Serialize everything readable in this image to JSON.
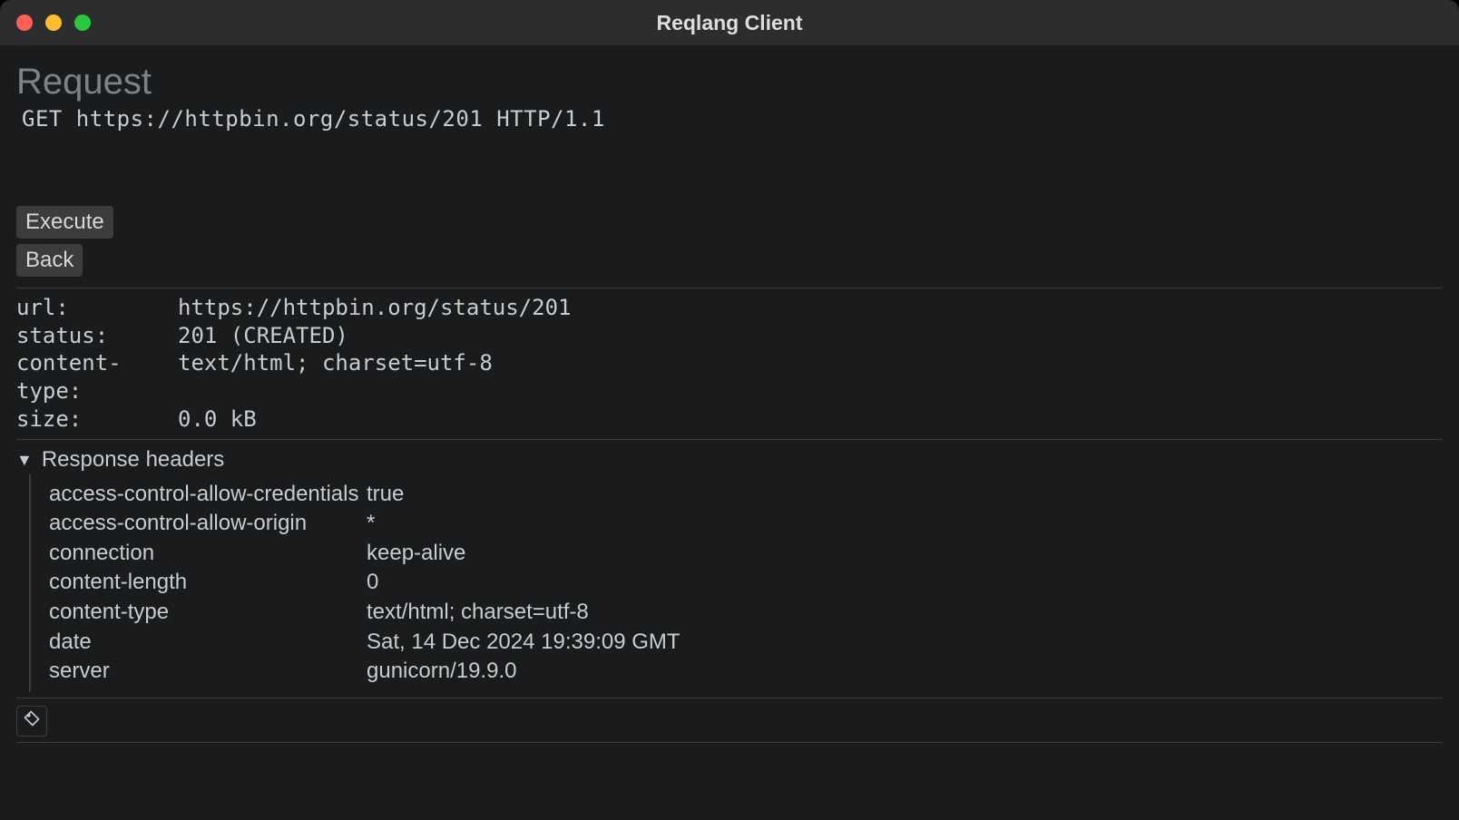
{
  "window": {
    "title": "Reqlang Client"
  },
  "page": {
    "heading": "Request",
    "request_line": "GET https://httpbin.org/status/201 HTTP/1.1"
  },
  "buttons": {
    "execute": "Execute",
    "back": "Back"
  },
  "summary": {
    "url": {
      "label": "url:",
      "value": "https://httpbin.org/status/201"
    },
    "status": {
      "label": "status:",
      "value": "201 (CREATED)"
    },
    "content_type": {
      "label": "content-type:",
      "value": "text/html; charset=utf-8"
    },
    "size": {
      "label": "size:",
      "value": "0.0 kB"
    }
  },
  "response_headers_section": {
    "title": "Response headers",
    "headers": [
      {
        "k": "access-control-allow-credentials",
        "v": "true"
      },
      {
        "k": "access-control-allow-origin",
        "v": "*"
      },
      {
        "k": "connection",
        "v": "keep-alive"
      },
      {
        "k": "content-length",
        "v": "0"
      },
      {
        "k": "content-type",
        "v": "text/html; charset=utf-8"
      },
      {
        "k": "date",
        "v": "Sat, 14 Dec 2024 19:39:09 GMT"
      },
      {
        "k": "server",
        "v": "gunicorn/19.9.0"
      }
    ]
  }
}
